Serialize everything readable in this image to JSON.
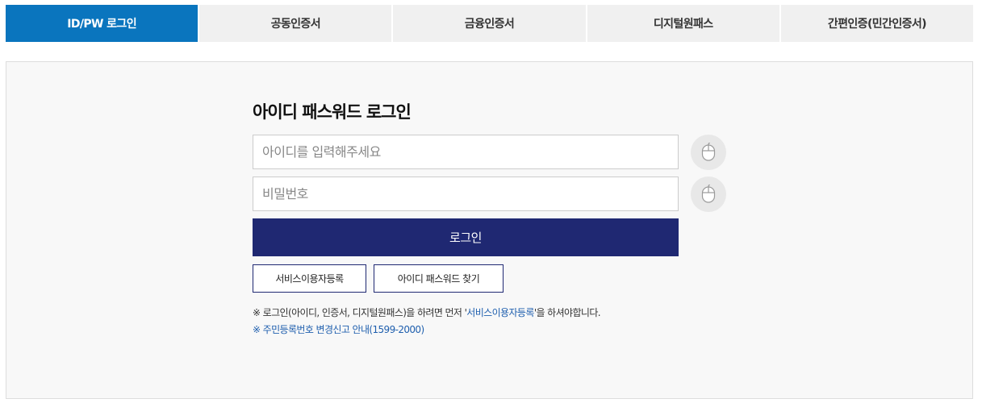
{
  "tabs": [
    {
      "label": "ID/PW 로그인",
      "active": true
    },
    {
      "label": "공동인증서",
      "active": false
    },
    {
      "label": "금융인증서",
      "active": false
    },
    {
      "label": "디지털원패스",
      "active": false
    },
    {
      "label": "간편인증(민간인증서)",
      "active": false
    }
  ],
  "login": {
    "title": "아이디 패스워드 로그인",
    "id_field": {
      "value": "",
      "placeholder": "아이디를 입력해주세요"
    },
    "pw_field": {
      "value": "",
      "placeholder": "비밀번호"
    },
    "submit_label": "로그인",
    "register_label": "서비스이용자등록",
    "find_label": "아이디 패스워드 찾기"
  },
  "notice": {
    "prefix": "※ 로그인(아이디, 인증서, 디지털원패스)을 하려면 먼저 '",
    "link": "서비스이용자등록",
    "suffix": "'을 하셔야합니다.",
    "rrn_link": "※ 주민등록번호 변경신고 안내(1599-2000)"
  },
  "colors": {
    "tab_active": "#0a75be",
    "tab_inactive": "#f0f0f0",
    "primary_button": "#1f2872",
    "link": "#1f5fae"
  },
  "icons": {
    "virtual_keyboard": "mouse-icon"
  }
}
